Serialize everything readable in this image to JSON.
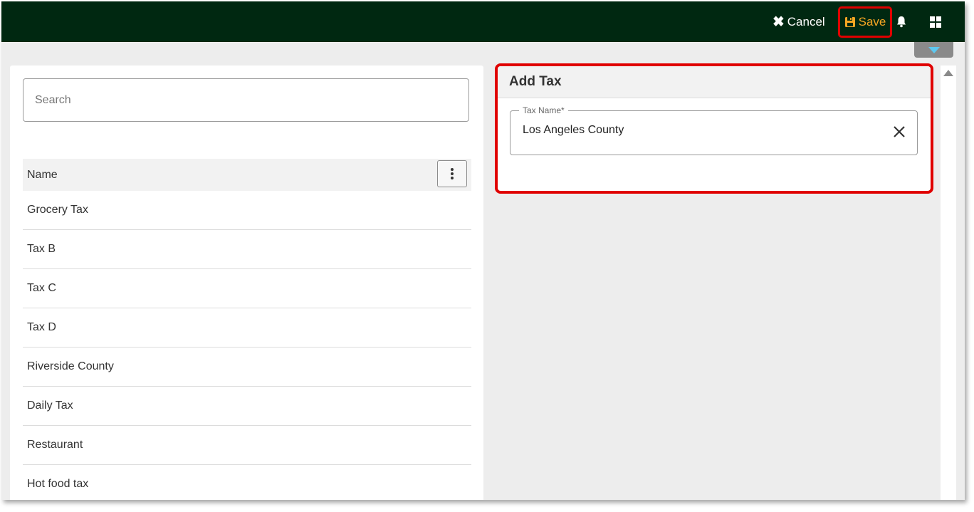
{
  "toolbar": {
    "cancel_label": "Cancel",
    "save_label": "Save",
    "cancel_icon": "close-icon",
    "save_icon": "floppy-disk-icon",
    "notification_icon": "bell-icon",
    "apps_icon": "grid-icon",
    "accent_color": "#f5a623",
    "bar_color": "#002811",
    "highlight_color": "#e00000"
  },
  "list": {
    "search_placeholder": "Search",
    "column_header": "Name",
    "menu_icon": "kebab-menu-icon",
    "rows": [
      "Grocery Tax",
      "Tax B",
      "Tax C",
      "Tax D",
      "Riverside County",
      "Daily Tax",
      "Restaurant",
      "Hot food tax"
    ]
  },
  "form": {
    "title": "Add Tax",
    "tax_name_label": "Tax Name*",
    "tax_name_value": "Los Angeles County",
    "clear_icon": "clear-icon"
  }
}
